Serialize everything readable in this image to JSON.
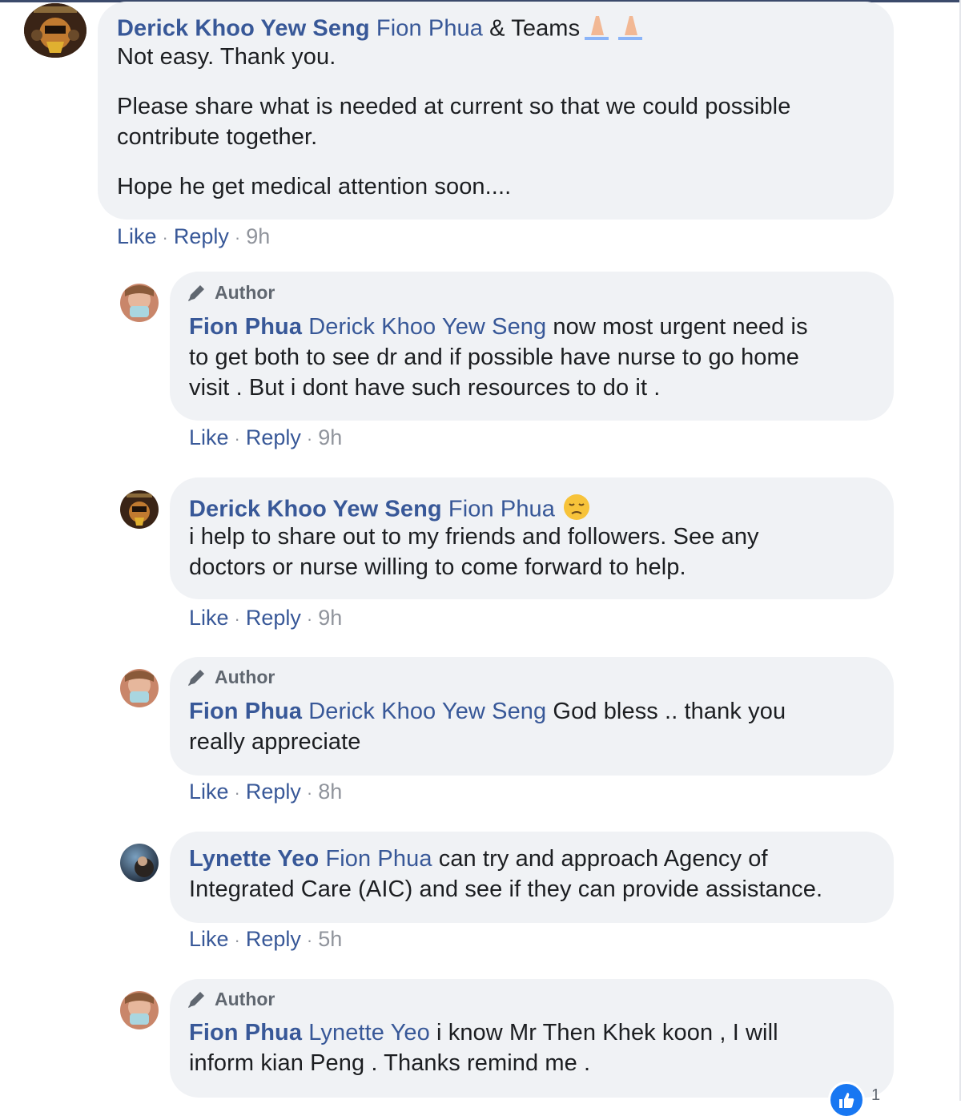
{
  "comments": [
    {
      "author": "Derick Khoo Yew Seng",
      "lines": [
        {
          "tag": "Fion Phua",
          "text": " & Teams"
        },
        {
          "text": "Not easy. Thank you."
        },
        {
          "text": "Please share what is needed at current so that we could possible"
        },
        {
          "text": "contribute together."
        },
        {
          "text": "Hope he get medical attention soon...."
        }
      ],
      "like": "Like",
      "reply": "Reply",
      "time": "9h"
    },
    {
      "badge": "Author",
      "author": "Fion Phua",
      "tag": "Derick Khoo Yew Seng",
      "lines": [
        " now most urgent need is",
        "to get both to see dr and if possible have nurse to go home",
        "visit . But i dont have such resources to do it ."
      ],
      "like": "Like",
      "reply": "Reply",
      "time": "9h"
    },
    {
      "author": "Derick Khoo Yew Seng",
      "tag": "Fion Phua",
      "lines": [
        "i help to share out to my friends and followers. See any",
        "doctors or nurse willing to come forward to help."
      ],
      "like": "Like",
      "reply": "Reply",
      "time": "9h"
    },
    {
      "badge": "Author",
      "author": "Fion Phua",
      "tag": "Derick Khoo Yew Seng",
      "lines": [
        " God bless .. thank you",
        "really appreciate"
      ],
      "like": "Like",
      "reply": "Reply",
      "time": "8h"
    },
    {
      "author": "Lynette Yeo",
      "tag": "Fion Phua",
      "lines": [
        " can try and approach Agency of",
        "Integrated Care (AIC) and see if they can provide assistance."
      ],
      "like": "Like",
      "reply": "Reply",
      "time": "5h"
    },
    {
      "badge": "Author",
      "author": "Fion Phua",
      "tag": "Lynette Yeo",
      "lines": [
        " i know Mr Then Khek koon , I will",
        "inform kian Peng . Thanks remind me ."
      ],
      "reaction_count": "1"
    }
  ],
  "colors": {
    "link": "#385898",
    "bubble": "#f0f2f5",
    "meta": "#90949c"
  }
}
